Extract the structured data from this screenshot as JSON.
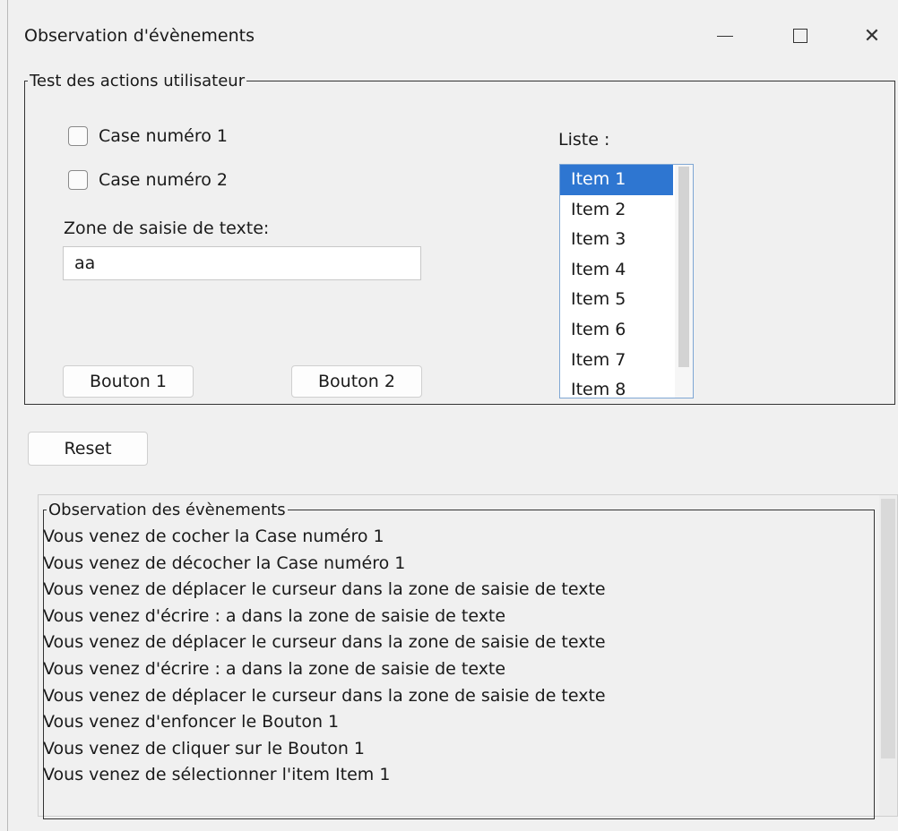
{
  "window": {
    "title": "Observation d'évènements",
    "controls": {
      "minimize": "minimize-icon",
      "maximize": "maximize-icon",
      "close": "close-icon"
    }
  },
  "test_group": {
    "legend": "Test des actions utilisateur",
    "checkbox1_label": "Case numéro 1",
    "checkbox2_label": "Case numéro 2",
    "text_label": "Zone de saisie de texte:",
    "text_value": "aa",
    "button1_label": "Bouton 1",
    "button2_label": "Bouton 2",
    "list_label": "Liste :",
    "list_items": [
      "Item 1",
      "Item 2",
      "Item 3",
      "Item 4",
      "Item 5",
      "Item 6",
      "Item 7",
      "Item 8"
    ],
    "selected_item": "Item 1"
  },
  "reset_label": "Reset",
  "observation": {
    "legend": "Observation des évènements",
    "lines": [
      "Vous venez de cocher la Case numéro 1",
      "Vous venez de décocher la Case numéro 1",
      "Vous venez de déplacer le curseur dans la zone de saisie de texte",
      "Vous venez d'écrire : a dans la zone de saisie de texte",
      "Vous venez de déplacer le curseur dans la zone de saisie de texte",
      "Vous venez d'écrire : a dans la zone de saisie de texte",
      "Vous venez de déplacer le curseur dans la zone de saisie de texte",
      "Vous venez d'enfoncer le Bouton 1",
      "Vous venez de cliquer sur le Bouton 1",
      "Vous venez de sélectionner l'item Item 1"
    ]
  },
  "colors": {
    "selection": "#2e76d1",
    "window_bg": "#f0f0f0"
  }
}
